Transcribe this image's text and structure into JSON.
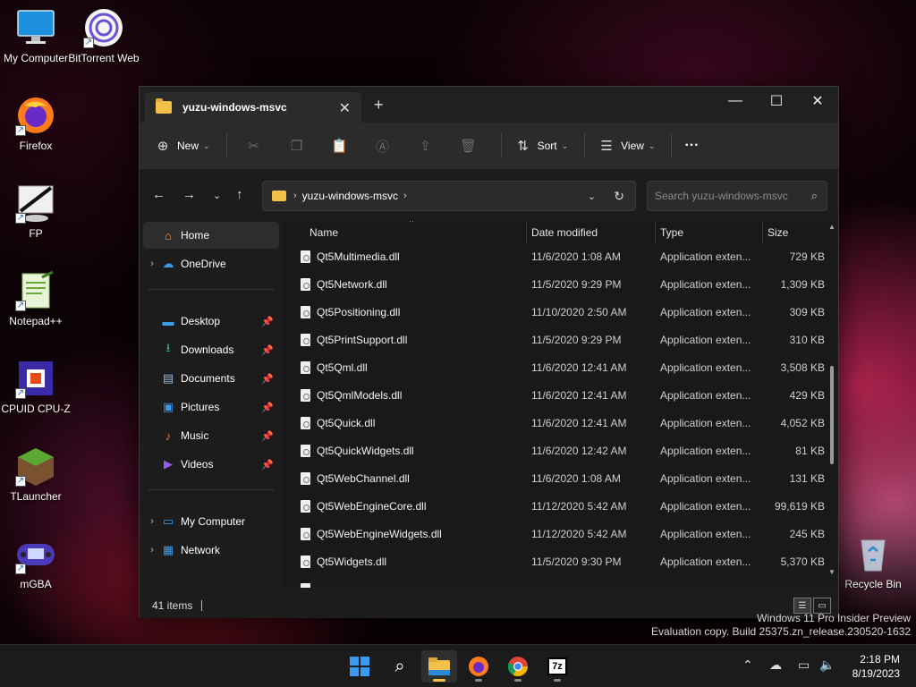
{
  "desktop": {
    "icons": [
      {
        "label": "My Computer",
        "icon": "monitor-icon"
      },
      {
        "label": "BitTorrent Web",
        "icon": "bittorrent-icon"
      },
      {
        "label": "Firefox",
        "icon": "firefox-icon"
      },
      {
        "label": "FP",
        "icon": "flashplayer-icon"
      },
      {
        "label": "Notepad++",
        "icon": "notepadpp-icon"
      },
      {
        "label": "CPUID CPU-Z",
        "icon": "cpuz-icon"
      },
      {
        "label": "TLauncher",
        "icon": "tlauncher-icon"
      },
      {
        "label": "mGBA",
        "icon": "mgba-icon"
      },
      {
        "label": "Recycle Bin",
        "icon": "recycle-bin-icon"
      }
    ],
    "watermark": {
      "line1": "Windows 11 Pro Insider Preview",
      "line2": "Evaluation copy. Build 25375.zn_release.230520-1632"
    }
  },
  "window": {
    "tab_title": "yuzu-windows-msvc",
    "new_tab": "+",
    "controls": {
      "minimize": "—",
      "maximize": "☐",
      "close": "✕"
    },
    "toolbar": {
      "new_label": "New",
      "sort_label": "Sort",
      "view_label": "View",
      "more_label": "···"
    },
    "address": {
      "crumb": "yuzu-windows-msvc",
      "search_placeholder": "Search yuzu-windows-msvc"
    },
    "sidebar": {
      "home": "Home",
      "onedrive": "OneDrive",
      "pinned": [
        "Desktop",
        "Downloads",
        "Documents",
        "Pictures",
        "Music",
        "Videos"
      ],
      "my_computer": "My Computer",
      "network": "Network"
    },
    "columns": {
      "name": "Name",
      "date": "Date modified",
      "type": "Type",
      "size": "Size"
    },
    "files": [
      {
        "name": "Qt5Multimedia.dll",
        "date": "11/6/2020 1:08 AM",
        "type": "Application exten...",
        "size": "729 KB"
      },
      {
        "name": "Qt5Network.dll",
        "date": "11/5/2020 9:29 PM",
        "type": "Application exten...",
        "size": "1,309 KB"
      },
      {
        "name": "Qt5Positioning.dll",
        "date": "11/10/2020 2:50 AM",
        "type": "Application exten...",
        "size": "309 KB"
      },
      {
        "name": "Qt5PrintSupport.dll",
        "date": "11/5/2020 9:29 PM",
        "type": "Application exten...",
        "size": "310 KB"
      },
      {
        "name": "Qt5Qml.dll",
        "date": "11/6/2020 12:41 AM",
        "type": "Application exten...",
        "size": "3,508 KB"
      },
      {
        "name": "Qt5QmlModels.dll",
        "date": "11/6/2020 12:41 AM",
        "type": "Application exten...",
        "size": "429 KB"
      },
      {
        "name": "Qt5Quick.dll",
        "date": "11/6/2020 12:41 AM",
        "type": "Application exten...",
        "size": "4,052 KB"
      },
      {
        "name": "Qt5QuickWidgets.dll",
        "date": "11/6/2020 12:42 AM",
        "type": "Application exten...",
        "size": "81 KB"
      },
      {
        "name": "Qt5WebChannel.dll",
        "date": "11/6/2020 1:08 AM",
        "type": "Application exten...",
        "size": "131 KB"
      },
      {
        "name": "Qt5WebEngineCore.dll",
        "date": "11/12/2020 5:42 AM",
        "type": "Application exten...",
        "size": "99,619 KB"
      },
      {
        "name": "Qt5WebEngineWidgets.dll",
        "date": "11/12/2020 5:42 AM",
        "type": "Application exten...",
        "size": "245 KB"
      },
      {
        "name": "Qt5Widgets.dll",
        "date": "11/5/2020 9:30 PM",
        "type": "Application exten...",
        "size": "5,370 KB"
      }
    ],
    "status": {
      "count": "41 items"
    }
  },
  "taskbar": {
    "apps": [
      "windows-start-icon",
      "search-icon",
      "file-explorer-icon",
      "firefox-icon",
      "chrome-icon",
      "7zip-icon"
    ],
    "time": "2:18 PM",
    "date": "8/19/2023"
  },
  "colors": {
    "folder": "#f3c14a",
    "window_bg": "#1c1c1c",
    "toolbar_bg": "#2b2b2b"
  }
}
